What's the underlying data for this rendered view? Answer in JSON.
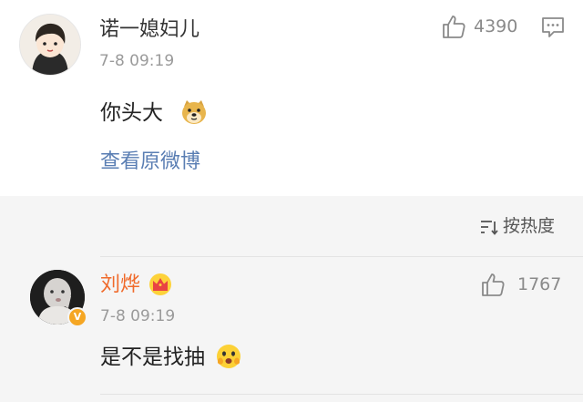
{
  "comment": {
    "username": "诺一媳妇儿",
    "time": "7-8 09:19",
    "text": "你头大",
    "emoji_icon": "doge-emoji-icon",
    "likes": "4390",
    "view_original_label": "查看原微博"
  },
  "sort": {
    "label": "按热度"
  },
  "reply": {
    "username": "刘烨",
    "badge_icon": "crown-vip-icon",
    "verified_mark": "V",
    "time": "7-8 09:19",
    "text": "是不是找抽",
    "emoji_icon": "fearful-face-emoji-icon",
    "likes": "1767"
  },
  "colors": {
    "vip_name": "#f06a2b",
    "link": "#5a7eb3",
    "verified_badge": "#f5a623",
    "background": "#f5f5f5"
  }
}
